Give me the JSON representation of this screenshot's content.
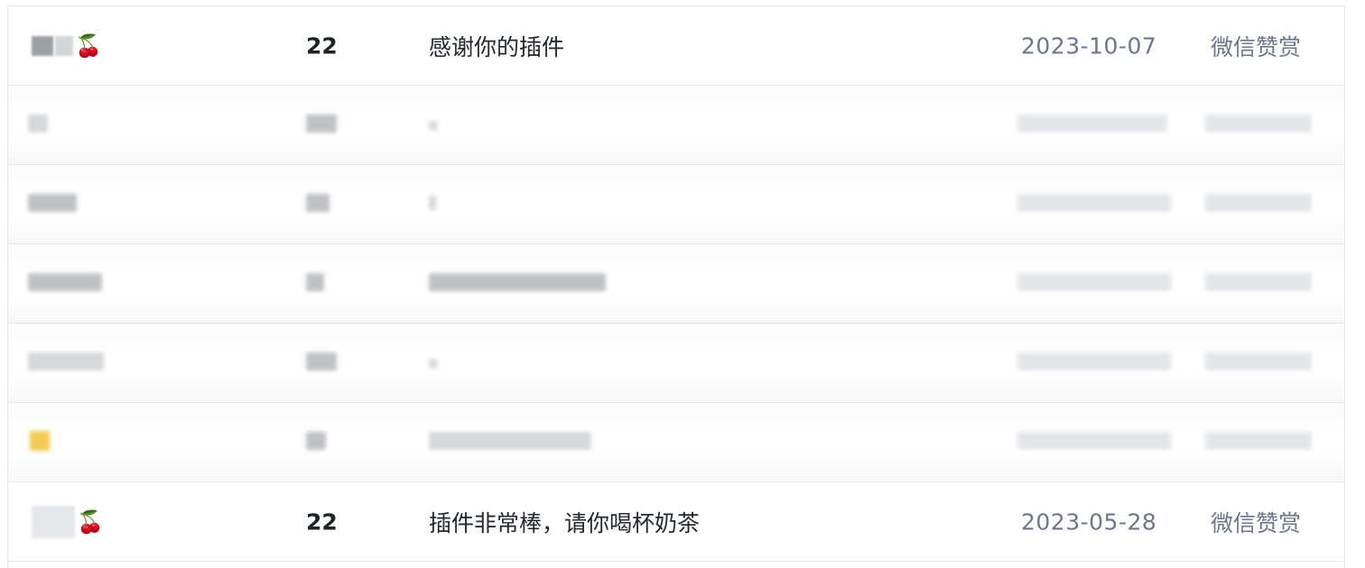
{
  "rows": [
    {
      "name_emoji": "🍒",
      "amount": "22",
      "message": "感谢你的插件",
      "date": "2023-10-07",
      "method": "微信赞赏"
    },
    {
      "name_emoji": "🍒",
      "amount": "22",
      "message": "插件非常棒，请你喝杯奶茶",
      "date": "2023-05-28",
      "method": "微信赞赏"
    }
  ],
  "colors": {
    "border": "#e6e8eb",
    "amount_text": "#1f2328",
    "muted_text": "#6b778c",
    "blur_highlight": "#f1c232"
  }
}
